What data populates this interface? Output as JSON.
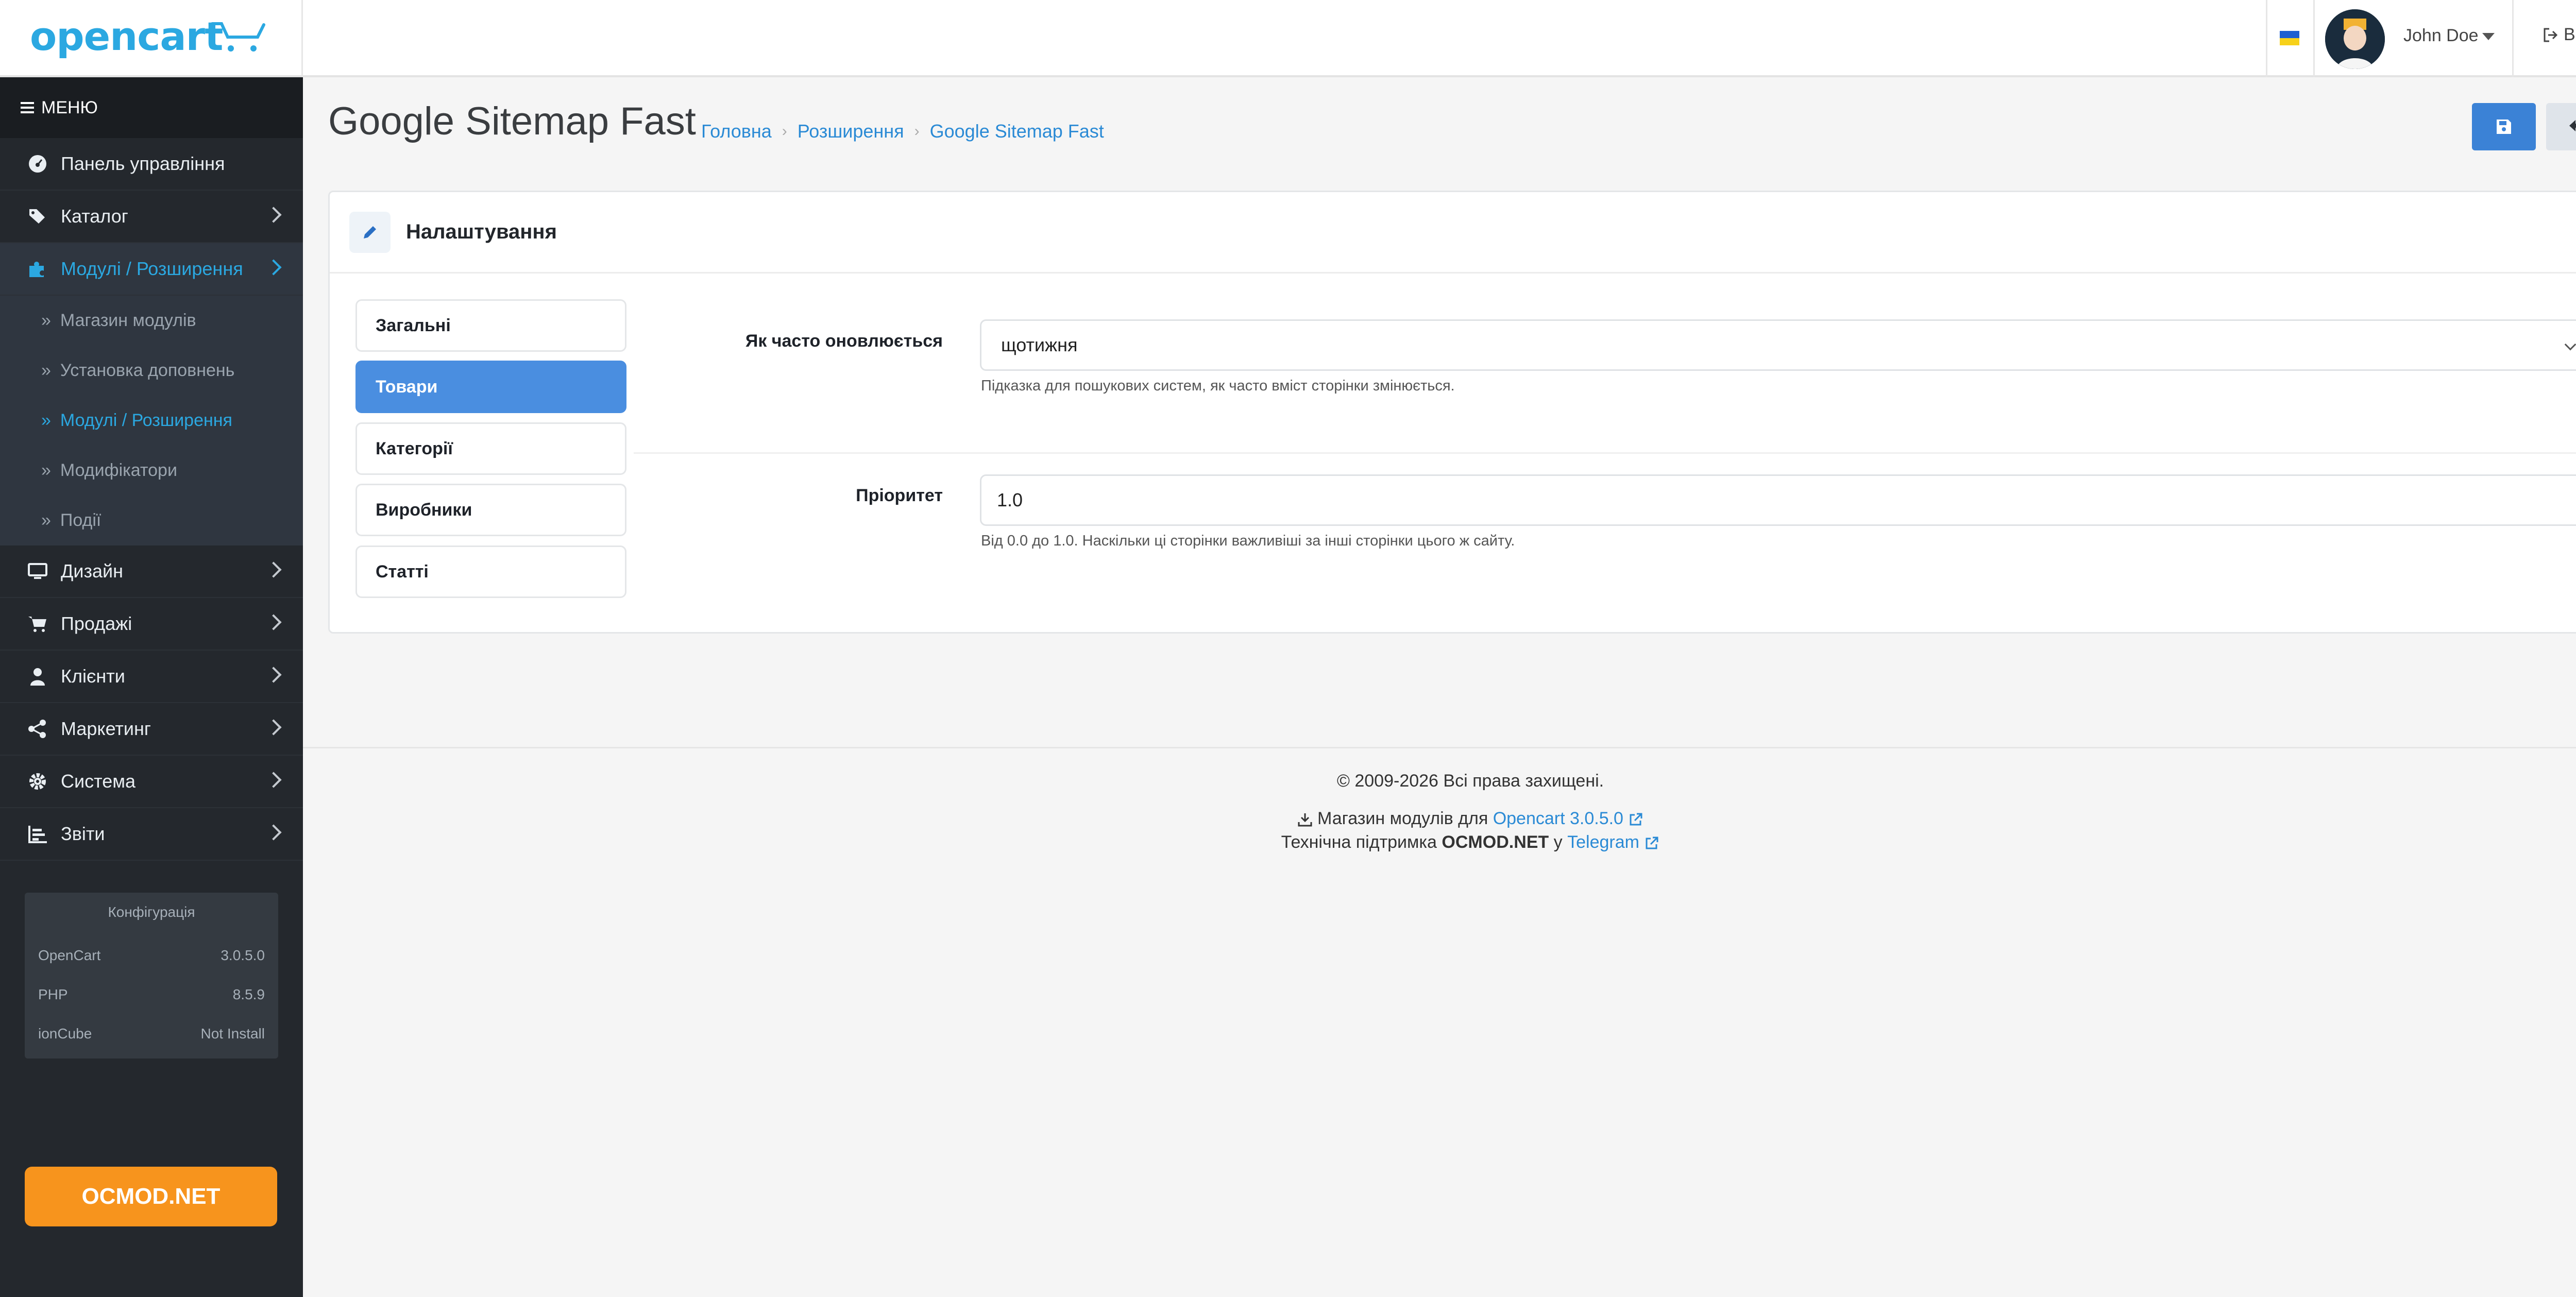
{
  "header": {
    "logo_text": "opencart",
    "user_name": "John Doe",
    "logout_label": "Вихід",
    "flag_colors": [
      "#1d5fd0",
      "#f7d11a"
    ]
  },
  "sidebar": {
    "menu_label": "МЕНЮ",
    "items": [
      {
        "label": "Панель управління",
        "icon": "dashboard-icon"
      },
      {
        "label": "Каталог",
        "icon": "tags-icon"
      },
      {
        "label": "Модулі / Розширення",
        "icon": "puzzle-icon",
        "active": true
      },
      {
        "label": "Дизайн",
        "icon": "desktop-icon"
      },
      {
        "label": "Продажі",
        "icon": "cart-icon"
      },
      {
        "label": "Клієнти",
        "icon": "user-icon"
      },
      {
        "label": "Маркетинг",
        "icon": "share-icon"
      },
      {
        "label": "Система",
        "icon": "gear-icon"
      },
      {
        "label": "Звіти",
        "icon": "chart-icon"
      }
    ],
    "subitems": [
      {
        "label": "Магазин модулів"
      },
      {
        "label": "Установка доповнень"
      },
      {
        "label": "Модулі / Розширення",
        "active": true
      },
      {
        "label": "Модифікатори"
      },
      {
        "label": "Події"
      }
    ],
    "config": {
      "title": "Конфігурація",
      "rows": [
        {
          "name": "OpenCart",
          "value": "3.0.5.0"
        },
        {
          "name": "PHP",
          "value": "8.5.9"
        },
        {
          "name": "ionCube",
          "value": "Not Install"
        }
      ]
    },
    "ocmod_button": "OCMOD.NET"
  },
  "page": {
    "title": "Google Sitemap Fast",
    "breadcrumb": [
      "Головна",
      "Розширення",
      "Google Sitemap Fast"
    ]
  },
  "card": {
    "title": "Налаштування",
    "tabs": [
      "Загальні",
      "Товари",
      "Категорії",
      "Виробники",
      "Статті"
    ],
    "active_tab": 1,
    "fields": {
      "frequency": {
        "label": "Як часто оновлюється",
        "value": "щотижня",
        "help": "Підказка для пошукових систем, як часто вміст сторінки змінюється."
      },
      "priority": {
        "label": "Пріоритет",
        "value": "1.0",
        "help": "Від 0.0 до 1.0. Наскільки ці сторінки важливіші за інші сторінки цього ж сайту."
      }
    }
  },
  "footer": {
    "copyright": "© 2009-2026 Всі права захищені.",
    "store_prefix": "Магазин модулів для",
    "store_link": "Opencart 3.0.5.0",
    "support_prefix": "Технічна підтримка",
    "support_brand": "OCMOD.NET",
    "support_mid": "у",
    "support_link": "Telegram"
  },
  "colors": {
    "accent": "#2ba8e1",
    "primary_button": "#3b82d6",
    "sidebar_bg": "#24282d",
    "ocmod_orange": "#f7941d"
  }
}
